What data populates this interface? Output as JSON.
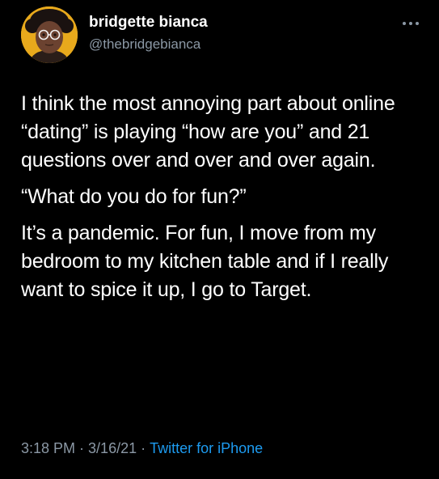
{
  "user": {
    "name": "bridgette bianca",
    "handle": "@thebridgebianca"
  },
  "tweet": {
    "paragraphs": [
      "I think the most annoying part about online “dating” is playing “how are you” and 21 questions over and over and over again.",
      "“What do you do for fun?”",
      "It’s a pandemic. For fun, I move from my bedroom to my kitchen table and if I really want to spice it up, I go to Target."
    ]
  },
  "meta": {
    "time": "3:18 PM",
    "date": "3/16/21",
    "separator": "·",
    "source": "Twitter for iPhone"
  },
  "icons": {
    "more": "more-options-icon"
  },
  "colors": {
    "background": "#000000",
    "text": "#ffffff",
    "secondary": "#8b98a5",
    "link": "#1d9bf0",
    "avatar_bg": "#e8a91c"
  }
}
